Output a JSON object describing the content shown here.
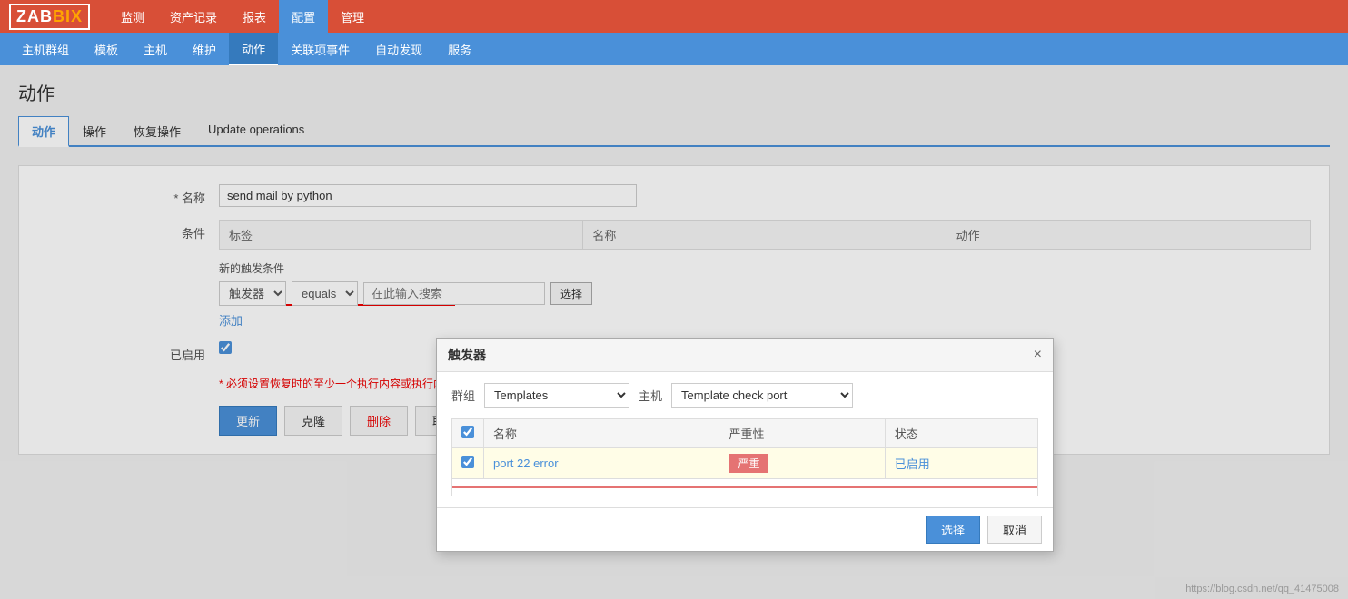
{
  "topNav": {
    "logo": "ZABBIX",
    "logoHighlight": "IX",
    "items": [
      {
        "label": "监测",
        "active": false
      },
      {
        "label": "资产记录",
        "active": false
      },
      {
        "label": "报表",
        "active": false
      },
      {
        "label": "配置",
        "active": true
      },
      {
        "label": "管理",
        "active": false
      }
    ]
  },
  "secondNav": {
    "items": [
      {
        "label": "主机群组",
        "active": false
      },
      {
        "label": "模板",
        "active": false
      },
      {
        "label": "主机",
        "active": false
      },
      {
        "label": "维护",
        "active": false
      },
      {
        "label": "动作",
        "active": true
      },
      {
        "label": "关联项事件",
        "active": false
      },
      {
        "label": "自动发现",
        "active": false
      },
      {
        "label": "服务",
        "active": false
      }
    ]
  },
  "pageTitle": "动作",
  "tabs": [
    {
      "label": "动作",
      "active": true
    },
    {
      "label": "操作",
      "active": false
    },
    {
      "label": "恢复操作",
      "active": false
    },
    {
      "label": "Update operations",
      "active": false
    }
  ],
  "form": {
    "nameLabel": "* 名称",
    "nameValue": "send mail by python",
    "conditionLabel": "条件",
    "conditionHeaders": [
      "标签",
      "名称",
      "动作"
    ],
    "newTriggerLabel": "新的触发条件",
    "triggerSelectDefault": "触发器",
    "equalsSelectDefault": "equals",
    "searchPlaceholder": "在此输入搜索",
    "selectButtonLabel": "选择",
    "addLinkLabel": "添加",
    "enabledLabel": "已启用",
    "warningText": "* 必须设置恢复时的至少一个执行内容或执行内容或更新时的执行内容。",
    "buttons": {
      "update": "更新",
      "clone": "克隆",
      "delete": "删除",
      "cancel": "取消"
    }
  },
  "modal": {
    "title": "触发器",
    "closeIcon": "×",
    "groupLabel": "群组",
    "groupValue": "Templates",
    "hostLabel": "主机",
    "hostValue": "Template check port",
    "tableHeaders": [
      "",
      "名称",
      "严重性",
      "状态"
    ],
    "rows": [
      {
        "checked": true,
        "name": "port 22 error",
        "severity": "严重",
        "status": "已启用"
      }
    ],
    "buttons": {
      "select": "选择",
      "cancel": "取消"
    }
  },
  "urlWatermark": "https://blog.csdn.net/qq_41475008"
}
